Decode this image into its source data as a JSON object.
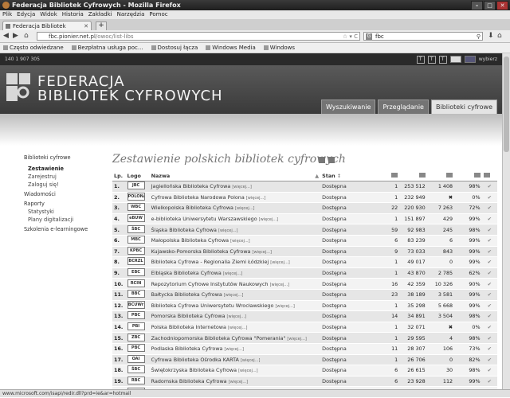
{
  "window": {
    "title": "Federacja Bibliotek Cyfrowych - Mozilla Firefox"
  },
  "menu": [
    "Plik",
    "Edycja",
    "Widok",
    "Historia",
    "Zakładki",
    "Narzędzia",
    "Pomoc"
  ],
  "tab": {
    "label": "Federacja Bibliotek Cyfrowych",
    "new_tab": "+"
  },
  "urlbar": {
    "domain": "fbc.",
    "host": "pionier.net.pl",
    "path": "/owoc/list-libs"
  },
  "search": {
    "engine": "G",
    "value": "fbc"
  },
  "bookmarks": [
    "Często odwiedzane",
    "Bezpłatna usługa poc...",
    "Dostosuj łącza",
    "Windows Media",
    "Windows"
  ],
  "topstrip": {
    "left": "140   1 907 305",
    "lang": "wybierz",
    "icons": [
      "T",
      "T",
      "T"
    ]
  },
  "brand": {
    "line1": "FEDERACJA",
    "line2": "BIBLIOTEK CYFROWYCH"
  },
  "nav_tabs": [
    "Wyszukiwanie",
    "Przeglądanie",
    "Biblioteki cyfrowe"
  ],
  "sidebar": {
    "title": "Biblioteki cyfrowe",
    "items": [
      {
        "label": "Zestawienie",
        "kind": "sel"
      },
      {
        "label": "Zarejestruj",
        "kind": "ind"
      },
      {
        "label": "Zaloguj się!",
        "kind": "ind"
      },
      {
        "label": "Wiadomości",
        "kind": "h"
      },
      {
        "label": "Raporty",
        "kind": "h"
      },
      {
        "label": "Statystyki",
        "kind": "ind"
      },
      {
        "label": "Plany digitalizacji",
        "kind": "ind"
      },
      {
        "label": "Szkolenia e-learningowe",
        "kind": "h"
      }
    ]
  },
  "heading": "Zestawienie polskich bibliotek cyfrowych",
  "table": {
    "headers": {
      "lp": "Lp.",
      "logo": "Logo",
      "name": "Nazwa",
      "status": "Stan"
    },
    "more": "[więcej...]",
    "rows": [
      {
        "lp": "1.",
        "logo": "JBC",
        "name": "Jagiellońska Biblioteka Cyfrowa",
        "status": "Dostępna",
        "c1": "1",
        "c2": "253 512",
        "c3": "1 408",
        "c4": "98%"
      },
      {
        "lp": "2.",
        "logo": "POLONA",
        "name": "Cyfrowa Biblioteka Narodowa Polona",
        "status": "Dostępna",
        "c1": "1",
        "c2": "232 949",
        "c3": "✖",
        "c4": "0%"
      },
      {
        "lp": "3.",
        "logo": "WBC",
        "name": "Wielkopolska Biblioteka Cyfrowa",
        "status": "Dostępna",
        "c1": "22",
        "c2": "220 930",
        "c3": "7 263",
        "c4": "72%"
      },
      {
        "lp": "4.",
        "logo": "eBUW",
        "name": "e-biblioteka Uniwersytetu Warszawskiego",
        "status": "Dostępna",
        "c1": "1",
        "c2": "151 897",
        "c3": "429",
        "c4": "99%"
      },
      {
        "lp": "5.",
        "logo": "ŚBC",
        "name": "Śląska Biblioteka Cyfrowa",
        "status": "Dostępna",
        "c1": "59",
        "c2": "92 983",
        "c3": "245",
        "c4": "98%"
      },
      {
        "lp": "6.",
        "logo": "MBC",
        "name": "Małopolska Biblioteka Cyfrowa",
        "status": "Dostępna",
        "c1": "6",
        "c2": "83 239",
        "c3": "6",
        "c4": "99%"
      },
      {
        "lp": "7.",
        "logo": "KPBC",
        "name": "Kujawsko-Pomorska Biblioteka Cyfrowa",
        "status": "Dostępna",
        "c1": "9",
        "c2": "73 033",
        "c3": "843",
        "c4": "99%"
      },
      {
        "lp": "8.",
        "logo": "BCRZL",
        "name": "Biblioteka Cyfrowa - Regionalia Ziemi Łódzkiej",
        "status": "Dostępna",
        "c1": "1",
        "c2": "49 017",
        "c3": "0",
        "c4": "99%"
      },
      {
        "lp": "9.",
        "logo": "EBC",
        "name": "Elbląska Biblioteka Cyfrowa",
        "status": "Dostępna",
        "c1": "1",
        "c2": "43 870",
        "c3": "2 785",
        "c4": "62%"
      },
      {
        "lp": "10.",
        "logo": "RCIN",
        "name": "Repozytorium Cyfrowe Instytutów Naukowych",
        "status": "Dostępna",
        "c1": "16",
        "c2": "42 359",
        "c3": "10 326",
        "c4": "90%"
      },
      {
        "lp": "11.",
        "logo": "BBC",
        "name": "Bałtycka Biblioteka Cyfrowa",
        "status": "Dostępna",
        "c1": "23",
        "c2": "38 189",
        "c3": "3 581",
        "c4": "99%"
      },
      {
        "lp": "12.",
        "logo": "BCUWr",
        "name": "Biblioteka Cyfrowa Uniwersytetu Wrocławskiego",
        "status": "Dostępna",
        "c1": "1",
        "c2": "35 298",
        "c3": "5 668",
        "c4": "99%"
      },
      {
        "lp": "13.",
        "logo": "PBC",
        "name": "Pomorska Biblioteka Cyfrowa",
        "status": "Dostępna",
        "c1": "14",
        "c2": "34 891",
        "c3": "3 504",
        "c4": "98%"
      },
      {
        "lp": "14.",
        "logo": "PBI",
        "name": "Polska Biblioteka Internetowa",
        "status": "Dostępna",
        "c1": "1",
        "c2": "32 071",
        "c3": "✖",
        "c4": "0%"
      },
      {
        "lp": "15.",
        "logo": "ZBC",
        "name": "Zachodniopomorska Biblioteka Cyfrowa \"Pomerania\"",
        "status": "Dostępna",
        "c1": "1",
        "c2": "29 595",
        "c3": "4",
        "c4": "98%"
      },
      {
        "lp": "16.",
        "logo": "PBC",
        "name": "Podlaska Biblioteka Cyfrowa",
        "status": "Dostępna",
        "c1": "11",
        "c2": "28 307",
        "c3": "106",
        "c4": "73%"
      },
      {
        "lp": "17.",
        "logo": "OAI",
        "name": "Cyfrowa Biblioteka Ośrodka KARTA",
        "status": "Dostępna",
        "c1": "1",
        "c2": "26 706",
        "c3": "0",
        "c4": "82%"
      },
      {
        "lp": "18.",
        "logo": "ŚBC",
        "name": "Świętokrzyska Biblioteka Cyfrowa",
        "status": "Dostępna",
        "c1": "6",
        "c2": "26 615",
        "c3": "30",
        "c4": "98%"
      },
      {
        "lp": "19.",
        "logo": "RBC",
        "name": "Radomska Biblioteka Cyfrowa",
        "status": "Dostępna",
        "c1": "6",
        "c2": "23 928",
        "c3": "112",
        "c4": "99%"
      },
      {
        "lp": "20.",
        "logo": "BCUŁ",
        "name": "Biblioteka Cyfrowa Uniwersytetu Łódzkiego",
        "status": "Dostępna",
        "c1": "1",
        "c2": "23 300",
        "c3": "0",
        "c4": "92%"
      }
    ]
  },
  "status_bar": "www.microsoft.com/isapi/redir.dll?prd=ie&ar=hotmail"
}
